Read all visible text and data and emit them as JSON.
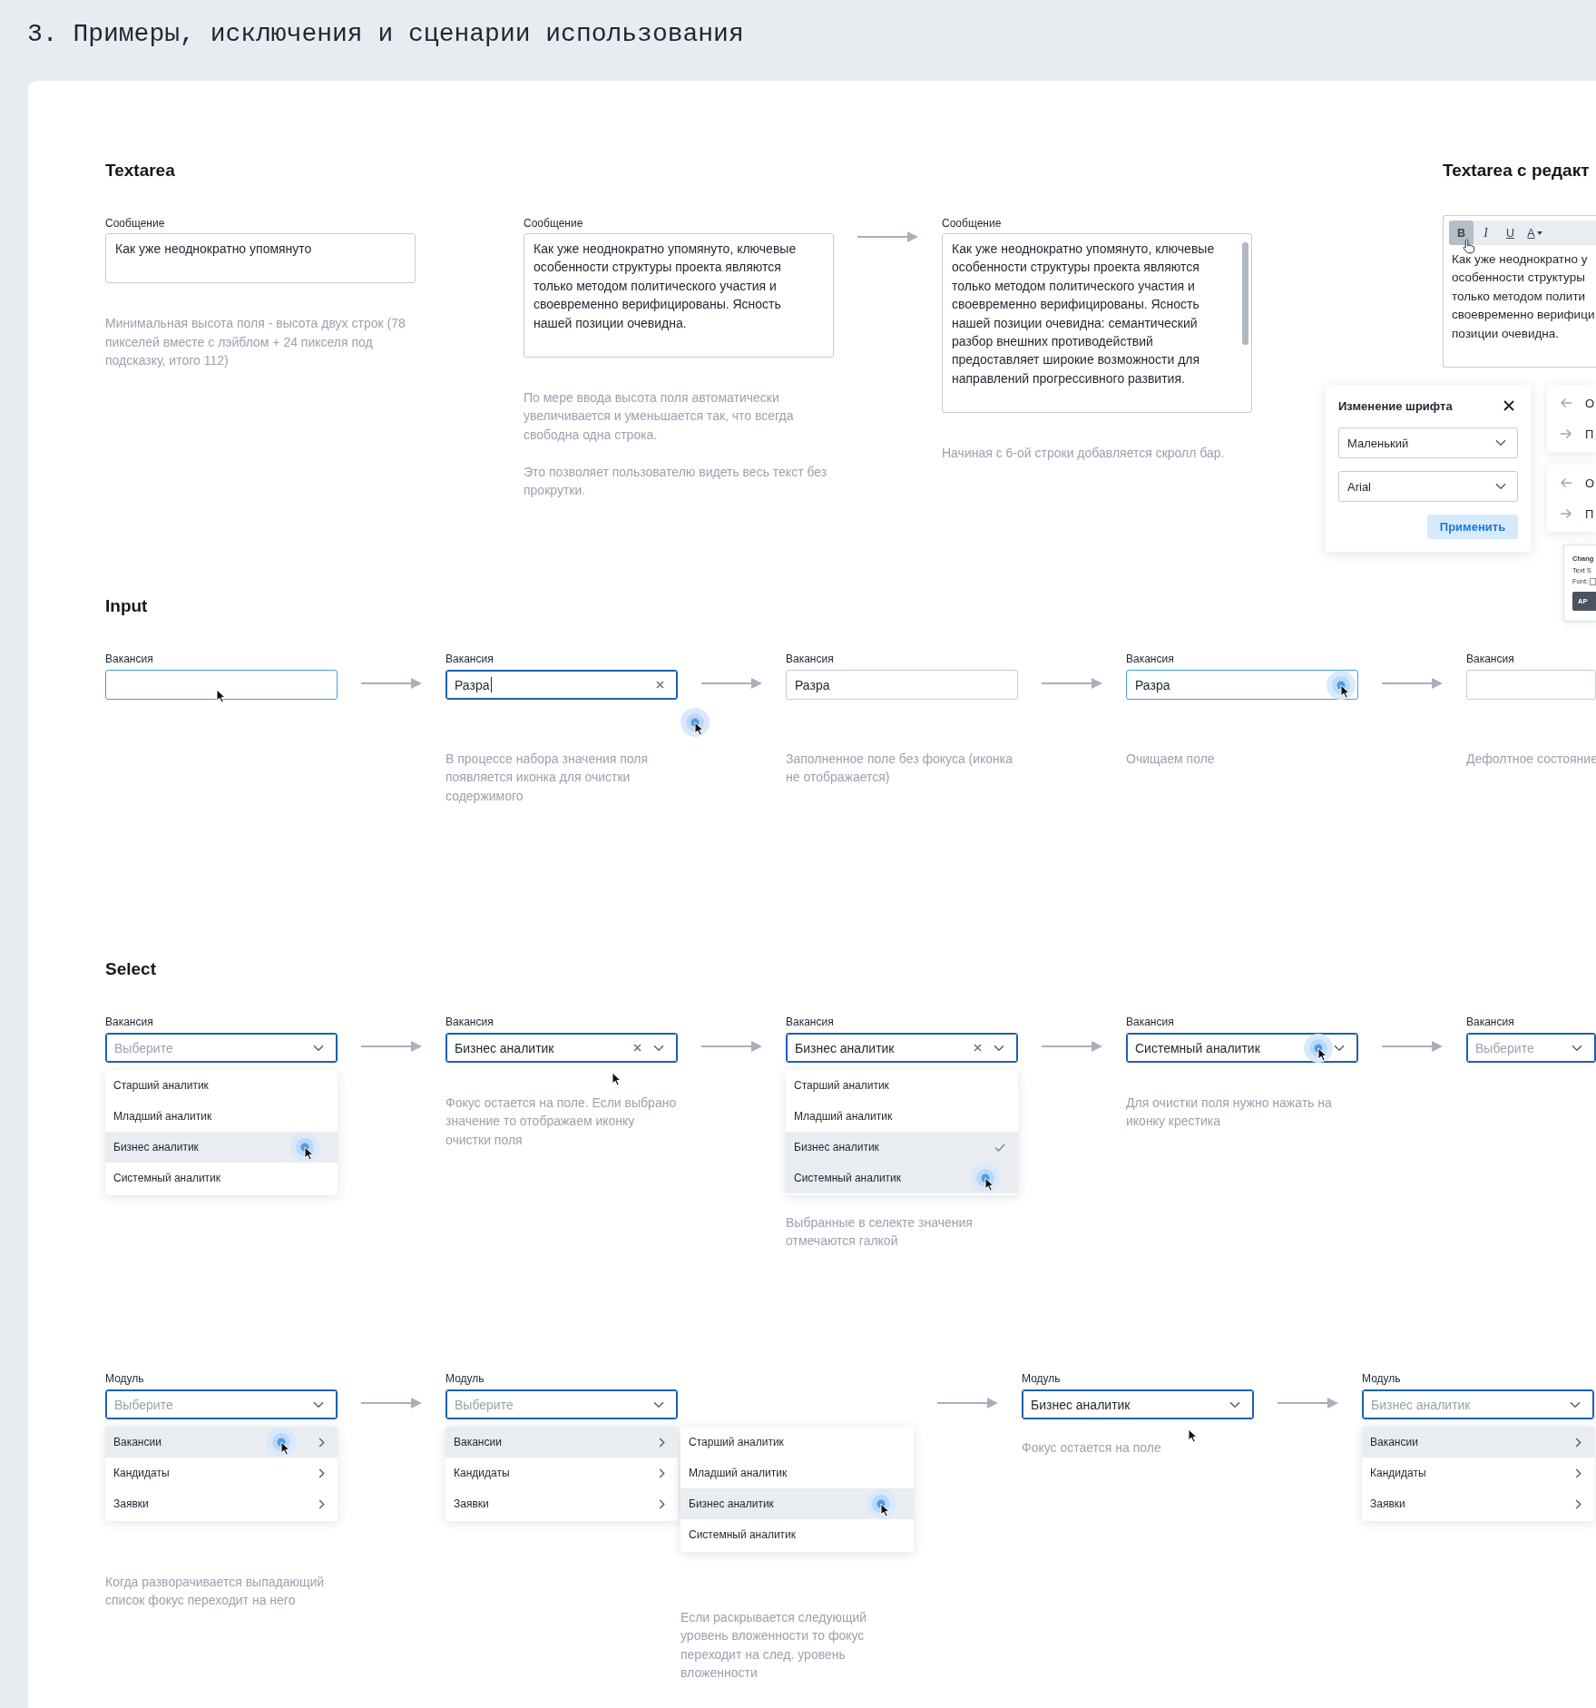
{
  "page": {
    "title": "3. Примеры, исключения и сценарии использования"
  },
  "textarea_section": {
    "heading": "Textarea",
    "steps": [
      {
        "label": "Сообщение",
        "value": "Как уже неоднократно упомянуто",
        "scrollable": false,
        "arrow_before": false,
        "hints": [
          "Минимальная высота поля - высота двух строк (78 пикселей вместе с лэйблом + 24 пикселя под подсказку, итого 112)"
        ]
      },
      {
        "label": "Сообщение",
        "value": "Как уже неоднократно упомянуто, ключевые особенности структуры проекта являются только методом политического участия и своевременно верифицированы. Ясность нашей позиции очевидна.",
        "scrollable": false,
        "arrow_before": false,
        "hints": [
          "По мере ввода высота поля автоматически увеличивается и уменьшается так, что всегда свободна одна строка.",
          "Это позволяет пользователю видеть весь текст без прокрутки."
        ]
      },
      {
        "label": "Сообщение",
        "value": "Как уже неоднократно упомянуто, ключевые особенности структуры проекта являются только методом политического участия и своевременно верифицированы. Ясность нашей позиции очевидна: семантический разбор внешних противодействий предоставляет широкие возможности для направлений прогрессивного развития.",
        "scrollable": true,
        "arrow_before": true,
        "hints": [
          "Начиная с 6-ой строки добавляется скролл бар."
        ]
      }
    ]
  },
  "editor_section": {
    "heading": "Textarea с редакт",
    "toolbar": [
      {
        "kind": "bold",
        "label": "B",
        "active": true,
        "cursor": {
          "kind": "hand"
        }
      },
      {
        "kind": "italic",
        "label": "I",
        "active": false
      },
      {
        "kind": "underline",
        "label": "U",
        "active": false
      },
      {
        "kind": "color",
        "label": "A",
        "active": false
      }
    ],
    "lines": [
      "Как уже неоднократно у",
      "особенности структуры",
      "только методом полити",
      "своевременно верифици",
      "позиции очевидна."
    ],
    "font_dialog": {
      "title": "Изменение шрифта",
      "selects": [
        {
          "value": "Маленький"
        },
        {
          "value": "Arial"
        }
      ],
      "button": "Применить"
    },
    "side_cards": [
      {
        "items": [
          {
            "kind": "back",
            "label": "О"
          },
          {
            "kind": "forward",
            "label": "П"
          }
        ]
      },
      {
        "items": [
          {
            "kind": "back",
            "label": "О"
          },
          {
            "kind": "forward",
            "label": "П"
          }
        ]
      }
    ],
    "mini_dialog": {
      "title": "Chang",
      "rows": [
        {
          "kind": "text",
          "label": "Text S"
        },
        {
          "kind": "field",
          "label": "Font:"
        }
      ],
      "button": "AP"
    }
  },
  "input_section": {
    "heading": "Input",
    "steps": [
      {
        "label": "Вакансия",
        "arrow_before": false,
        "field": {
          "kind": "input",
          "focused": false,
          "hovered": true,
          "cursor": {
            "kind": "pointer"
          }
        }
      },
      {
        "label": "Вакансия",
        "arrow_before": true,
        "field": {
          "kind": "input",
          "focused": true,
          "value": "Разра",
          "caret": true,
          "clearable": true
        },
        "cursor": {
          "kind": "click"
        },
        "hints": [
          "В процессе набора значения поля появляется иконка для очистки содержимого"
        ]
      },
      {
        "label": "Вакансия",
        "arrow_before": true,
        "field": {
          "kind": "input",
          "focused": false,
          "hovered": false,
          "value": "Разра"
        },
        "hints": [
          "Заполненное поле без фокуса (иконка не отображается)"
        ]
      },
      {
        "label": "Вакансия",
        "arrow_before": true,
        "field": {
          "kind": "input",
          "focused": false,
          "hovered": true,
          "value": "Разра",
          "clearable": true,
          "clear_cursor": {
            "kind": "click"
          }
        },
        "hints": [
          "Очищаем поле"
        ]
      },
      {
        "label": "Вакансия",
        "arrow_before": true,
        "field": {
          "kind": "input",
          "focused": false,
          "hovered": false
        },
        "hints": [
          "Дефолтное состояние"
        ]
      }
    ]
  },
  "select_section": {
    "heading": "Select",
    "steps": [
      {
        "label": "Вакансия",
        "arrow_before": false,
        "field": {
          "kind": "select",
          "focused": true,
          "placeholder": "Выберите"
        },
        "menu": [
          {
            "label": "Старший аналитик",
            "highlighted": false,
            "selected": false
          },
          {
            "label": "Младший аналитик",
            "highlighted": false,
            "selected": false
          },
          {
            "label": "Бизнес аналитик",
            "highlighted": true,
            "selected": false,
            "cursor": {
              "kind": "click"
            }
          },
          {
            "label": "Системный аналитик",
            "highlighted": false,
            "selected": false
          }
        ]
      },
      {
        "label": "Вакансия",
        "arrow_before": true,
        "field": {
          "kind": "select",
          "focused": true,
          "value": "Бизнес аналитик",
          "clearable": true
        },
        "cursor": {
          "kind": "pointer"
        },
        "hints": [
          "Фокус остается на поле. Если выбрано значение то отображаем иконку очистки поля"
        ]
      },
      {
        "label": "Вакансия",
        "arrow_before": true,
        "field": {
          "kind": "select",
          "focused": true,
          "value": "Бизнес аналитик",
          "clearable": true
        },
        "menu": [
          {
            "label": "Старший аналитик",
            "highlighted": false,
            "selected": false
          },
          {
            "label": "Младший аналитик",
            "highlighted": false,
            "selected": false
          },
          {
            "label": "Бизнес аналитик",
            "highlighted": true,
            "selected": true
          },
          {
            "label": "Системный аналитик",
            "highlighted": true,
            "selected": false,
            "cursor": {
              "kind": "click"
            }
          }
        ],
        "hints": [
          "Выбранные в селекте значения отмечаются галкой"
        ]
      },
      {
        "label": "Вакансия",
        "arrow_before": true,
        "field": {
          "kind": "select",
          "focused": true,
          "value": "Системный аналитик",
          "clearable": true,
          "clear_cursor": {
            "kind": "click"
          }
        },
        "hints": [
          "Для очистки поля нужно нажать на иконку крестика"
        ]
      },
      {
        "label": "Вакансия",
        "arrow_before": true,
        "field": {
          "kind": "select",
          "focused": true,
          "placeholder": "Выберите"
        }
      }
    ]
  },
  "module_section": {
    "steps": [
      {
        "label": "Модуль",
        "arrow_before": false,
        "field": {
          "kind": "select",
          "focused": true,
          "placeholder": "Выберите"
        },
        "menu": [
          {
            "label": "Вакансии",
            "highlighted": true,
            "selected": false,
            "expandable": true,
            "cursor": {
              "kind": "click"
            }
          },
          {
            "label": "Кандидаты",
            "highlighted": false,
            "selected": false,
            "expandable": true
          },
          {
            "label": "Заявки",
            "highlighted": false,
            "selected": false,
            "expandable": true
          }
        ],
        "hints": [
          "Когда разворачивается выпадающий список фокус переходит на него"
        ]
      },
      {
        "label": "Модуль",
        "arrow_before": true,
        "field": {
          "kind": "select",
          "focused": true,
          "placeholder": "Выберите"
        },
        "menu": [
          {
            "label": "Вакансии",
            "highlighted": true,
            "selected": false,
            "expandable": true
          },
          {
            "label": "Кандидаты",
            "highlighted": false,
            "selected": false,
            "expandable": true
          },
          {
            "label": "Заявки",
            "highlighted": false,
            "selected": false,
            "expandable": true
          }
        ],
        "submenu": [
          {
            "label": "Старший аналитик",
            "highlighted": false,
            "selected": false
          },
          {
            "label": "Младший аналитик",
            "highlighted": false,
            "selected": false
          },
          {
            "label": "Бизнес аналитик",
            "highlighted": true,
            "selected": false,
            "cursor": {
              "kind": "click"
            }
          },
          {
            "label": "Системный аналитик",
            "highlighted": false,
            "selected": false
          }
        ],
        "hints": [
          "Если раскрывается следующий уровень вложенности то фокус переходит на след. уровень вложенности"
        ]
      },
      {
        "label": "Модуль",
        "arrow_before": true,
        "field": {
          "kind": "select",
          "focused": true,
          "value": "Бизнес аналитик"
        },
        "cursor": {
          "kind": "pointer"
        },
        "hints": [
          "Фокус остается на поле"
        ]
      },
      {
        "label": "Модуль",
        "arrow_before": true,
        "field": {
          "kind": "select",
          "focused": true,
          "placeholder": "Бизнес аналитик"
        },
        "menu": [
          {
            "label": "Вакансии",
            "highlighted": true,
            "selected": false,
            "expandable": true
          },
          {
            "label": "Кандидаты",
            "highlighted": false,
            "selected": false,
            "expandable": true
          },
          {
            "label": "Заявки",
            "highlighted": false,
            "selected": false,
            "expandable": true
          }
        ]
      }
    ]
  }
}
